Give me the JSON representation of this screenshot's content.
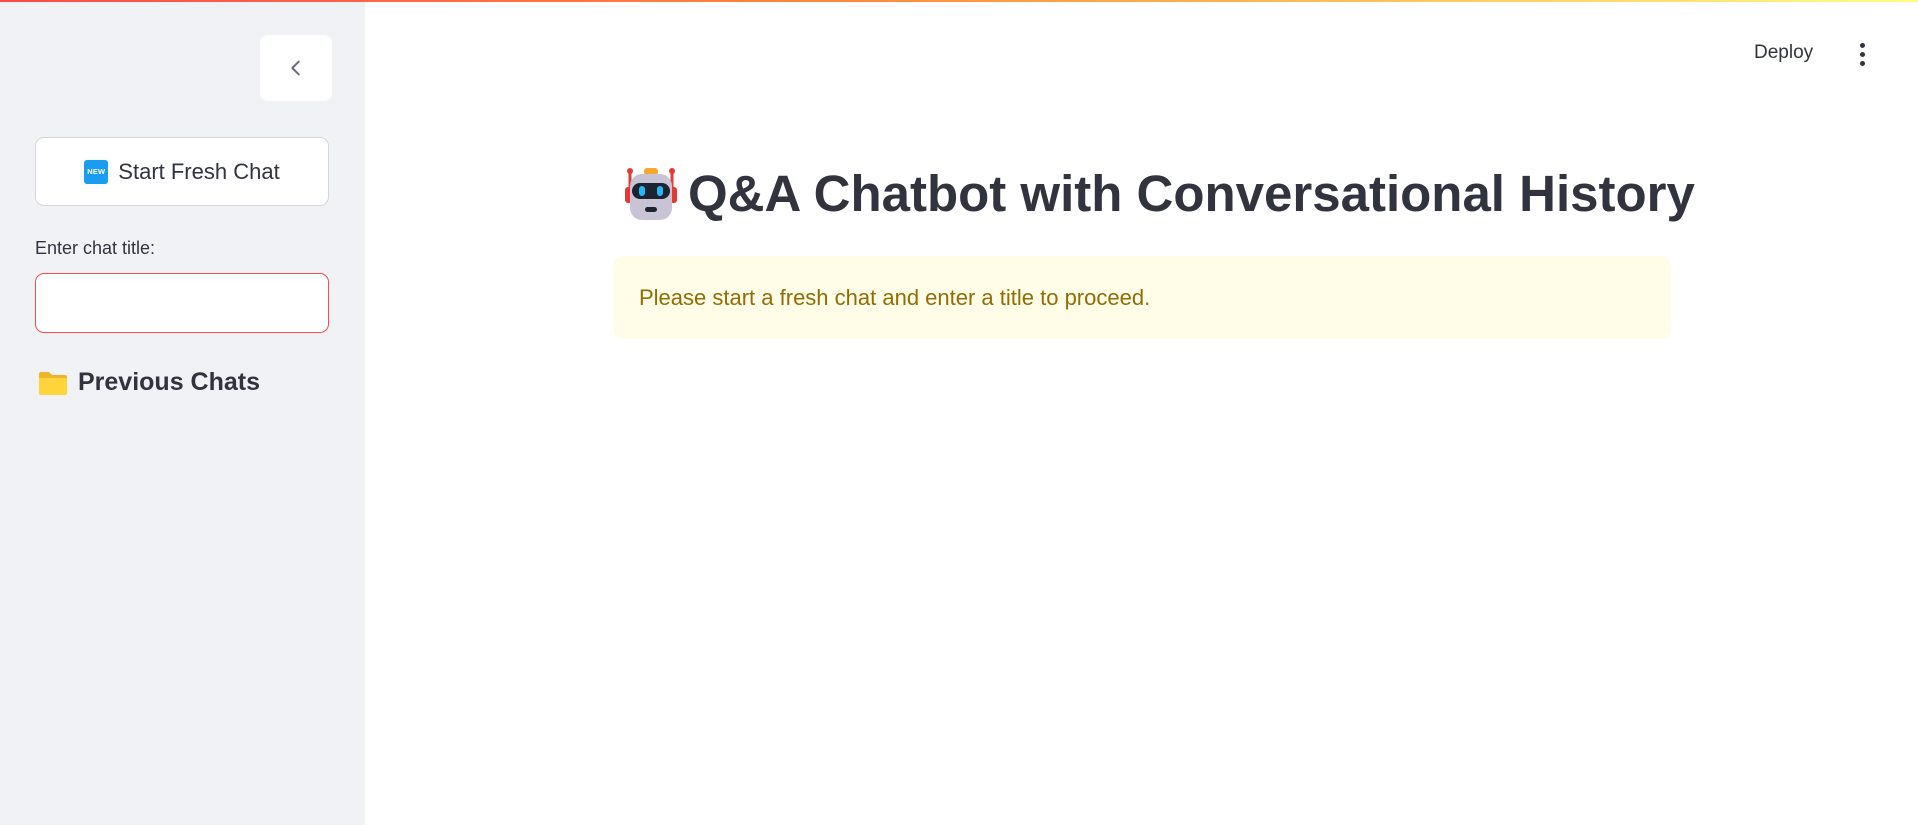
{
  "app": {
    "accent_color": "#ff4b4b"
  },
  "header": {
    "deploy_label": "Deploy",
    "menu_icon": "more-vertical-icon"
  },
  "sidebar": {
    "collapse_icon": "chevron-left-icon",
    "new_chat_button": {
      "icon": "new-badge-icon",
      "icon_text": "NEW",
      "label": "Start Fresh Chat"
    },
    "chat_title_field": {
      "label": "Enter chat title:",
      "value": "",
      "placeholder": ""
    },
    "previous_chats": {
      "icon": "folder-icon",
      "label": "Previous Chats"
    }
  },
  "main": {
    "title_icon": "robot-icon",
    "title": "Q&A Chatbot with Conversational History",
    "warning": {
      "text": "Please start a fresh chat and enter a title to proceed.",
      "background": "#fffce7",
      "text_color": "#926c05"
    }
  }
}
